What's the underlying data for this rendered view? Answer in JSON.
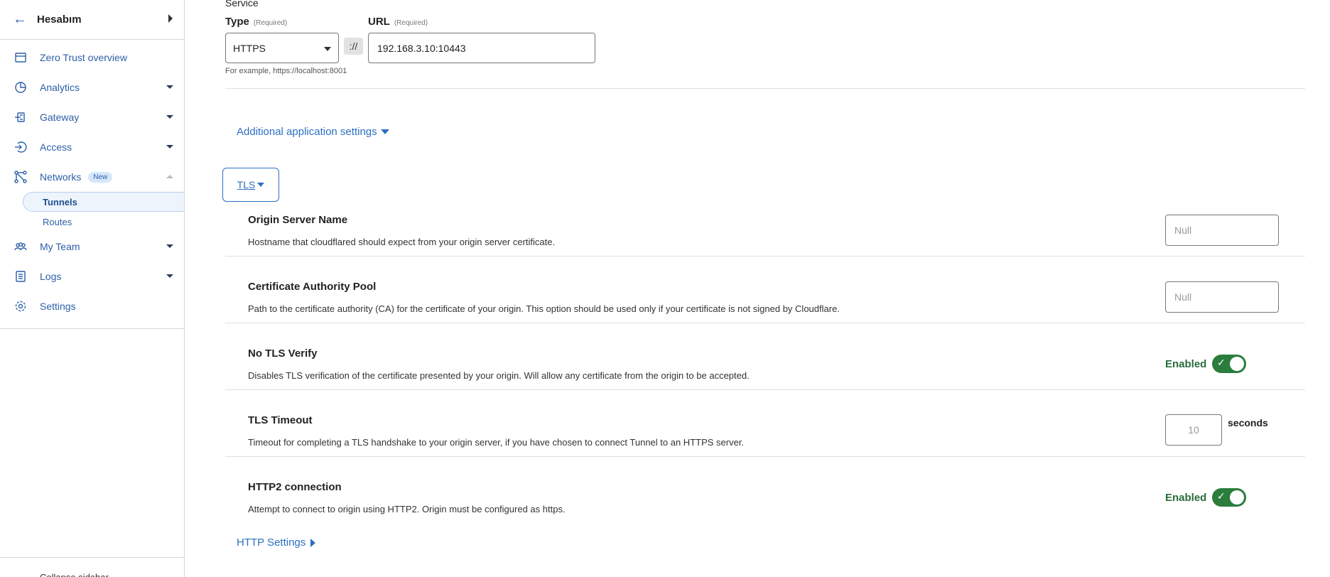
{
  "sidebar": {
    "account": "Hesabım",
    "items": [
      {
        "label": "Zero Trust overview"
      },
      {
        "label": "Analytics"
      },
      {
        "label": "Gateway"
      },
      {
        "label": "Access"
      },
      {
        "label": "Networks",
        "badge": "New"
      },
      {
        "label": "My Team"
      },
      {
        "label": "Logs"
      },
      {
        "label": "Settings"
      }
    ],
    "subitems": [
      {
        "label": "Tunnels"
      },
      {
        "label": "Routes"
      }
    ],
    "footer": "Collapse sidebar"
  },
  "service": {
    "section_label": "Service",
    "type_label": "Type",
    "type_required": "(Required)",
    "type_value": "HTTPS",
    "separator": "://",
    "url_label": "URL",
    "url_required": "(Required)",
    "url_value": "192.168.3.10:10443",
    "hint": "For example, https://localhost:8001"
  },
  "additional_settings": "Additional application settings",
  "tls": {
    "button_label": "TLS",
    "origin_server_name": {
      "title": "Origin Server Name",
      "desc": "Hostname that cloudflared should expect from your origin server certificate.",
      "placeholder": "Null"
    },
    "ca_pool": {
      "title": "Certificate Authority Pool",
      "desc": "Path to the certificate authority (CA) for the certificate of your origin. This option should be used only if your certificate is not signed by Cloudflare.",
      "placeholder": "Null"
    },
    "no_tls_verify": {
      "title": "No TLS Verify",
      "desc": "Disables TLS verification of the certificate presented by your origin. Will allow any certificate from the origin to be accepted.",
      "status": "Enabled"
    },
    "tls_timeout": {
      "title": "TLS Timeout",
      "desc": "Timeout for completing a TLS handshake to your origin server, if you have chosen to connect Tunnel to an HTTPS server.",
      "placeholder": "10",
      "unit": "seconds"
    },
    "http2": {
      "title": "HTTP2 connection",
      "desc": "Attempt to connect to origin using HTTP2. Origin must be configured as https.",
      "status": "Enabled"
    }
  },
  "http_settings": "HTTP Settings",
  "colors": {
    "link": "#2c6fc2",
    "toggle_on": "#2a7d3d",
    "enabled_text": "#2a6b3c"
  }
}
